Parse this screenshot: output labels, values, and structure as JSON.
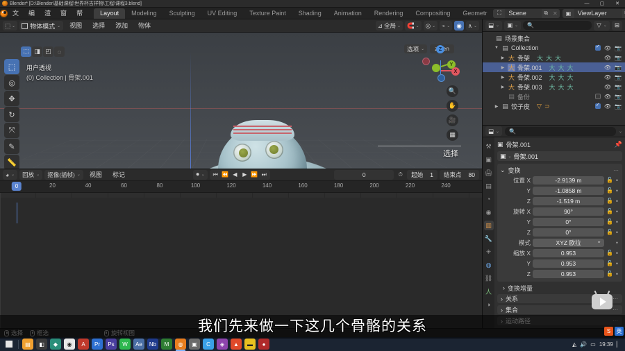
{
  "titlebar": {
    "app_title": "Blender* [D:\\Blender\\基础课程\\世界杯吉祥物\\工程\\课程3.blend]",
    "minimize": "—",
    "maximize": "▢",
    "close": "✕"
  },
  "topbar": {
    "menus": [
      "文件",
      "编辑",
      "渲染",
      "窗口",
      "帮助"
    ],
    "workspace_tabs": [
      {
        "label": "Layout",
        "active": true
      },
      {
        "label": "Modeling",
        "active": false
      },
      {
        "label": "Sculpting",
        "active": false
      },
      {
        "label": "UV Editing",
        "active": false
      },
      {
        "label": "Texture Paint",
        "active": false
      },
      {
        "label": "Shading",
        "active": false
      },
      {
        "label": "Animation",
        "active": false
      },
      {
        "label": "Rendering",
        "active": false
      },
      {
        "label": "Compositing",
        "active": false
      },
      {
        "label": "Geometr",
        "active": false
      }
    ],
    "scene_name": "Scene",
    "viewlayer_name": "ViewLayer",
    "scene_icon": "scene-icon",
    "viewlayer_icon": "viewlayer-icon",
    "new_icon": "new-copy-icon",
    "remove_icon": "remove-x-icon"
  },
  "viewport_header": {
    "editor_type_icon": "editor-type-3dview-icon",
    "mode": "物体模式",
    "menus": [
      "视图",
      "选择",
      "添加",
      "物体"
    ],
    "transform_orientation": "全局",
    "snap_icon": "magnet-icon",
    "proportional_icon": "proportional-edit-icon",
    "overlay_icon": "overlays-icon",
    "xray_icon": "xray-icon",
    "shading_modes": [
      "wireframe",
      "solid",
      "material-preview",
      "rendered"
    ],
    "shading_active": "solid"
  },
  "viewport": {
    "header_gizmos": [
      "select-box-icon",
      "select-tweak-icon",
      "select-lasso-icon",
      "select-circle-icon"
    ],
    "view_label_line1": "用户透视",
    "view_label_line2": "(0) Collection | 骨架.001",
    "options_label": "选项",
    "language_toggle": "zh/en",
    "select_label": "选择",
    "toolbar_icons": [
      "tweak-tool-icon",
      "cursor-tool-icon",
      "move-tool-icon",
      "rotate-tool-icon",
      "scale-tool-icon",
      "annotate-tool-icon",
      "measure-tool-icon",
      "add-cube-tool-icon"
    ],
    "nav_axes": [
      {
        "label": "Z",
        "color": "#4a8fe0"
      },
      {
        "label": "Y",
        "color": "#8cbd2a"
      },
      {
        "label": "X",
        "color": "#e0575f"
      }
    ],
    "nav_buttons": [
      "zoom-icon",
      "pan-hand-icon",
      "camera-view-icon",
      "toggle-ortho-grid-icon"
    ]
  },
  "timeline": {
    "editor_icon": "editor-type-timeline-icon",
    "playback_menu": "回放",
    "keying_menu": "抠像(插帧)",
    "menus": [
      "视图",
      "标记"
    ],
    "record_icon": "auto-key-record-icon",
    "transport": [
      "jump-start-icon",
      "prev-keyframe-icon",
      "play-reverse-icon",
      "play-icon",
      "next-keyframe-icon",
      "jump-end-icon"
    ],
    "current_frame": "0",
    "clock_icon": "clock-icon",
    "start_label": "起始",
    "start_value": "1",
    "end_label": "结束点",
    "end_value": "80",
    "ruler_ticks": [
      "0",
      "20",
      "40",
      "60",
      "80",
      "100",
      "120",
      "140",
      "160",
      "180",
      "200",
      "220",
      "240"
    ],
    "playhead_label": "0"
  },
  "outliner": {
    "display_mode_icon": "outliner-display-mode-icon",
    "filter_id_icon": "outliner-id-type-icon",
    "search_placeholder": "",
    "search_icon": "search-icon",
    "filter_icon": "filter-funnel-icon",
    "new_collection_icon": "new-collection-icon",
    "rows": [
      {
        "label": "场景集合",
        "icon": "collection-icon",
        "indent": 0,
        "disclosure": "",
        "selected": false,
        "dim": false,
        "checkbox": null,
        "eye": false,
        "camera": false,
        "armature_icons": []
      },
      {
        "label": "Collection",
        "icon": "collection-icon",
        "indent": 1,
        "disclosure": "▼",
        "selected": false,
        "dim": false,
        "checkbox": "on",
        "eye": true,
        "camera": true,
        "armature_icons": []
      },
      {
        "label": "骨架",
        "icon": "armature-icon",
        "indent": 2,
        "disclosure": "▶",
        "selected": false,
        "dim": false,
        "checkbox": null,
        "eye": true,
        "camera": true,
        "armature_icons": [
          "pose-icon",
          "armature-data-icon",
          "bone-icon"
        ]
      },
      {
        "label": "骨架.001",
        "icon": "armature-icon",
        "indent": 2,
        "disclosure": "▶",
        "selected": true,
        "dim": false,
        "checkbox": null,
        "eye": true,
        "camera": true,
        "armature_icons": [
          "pose-icon",
          "armature-data-icon",
          "bone-icon"
        ]
      },
      {
        "label": "骨架.002",
        "icon": "armature-icon",
        "indent": 2,
        "disclosure": "▶",
        "selected": false,
        "dim": false,
        "checkbox": null,
        "eye": true,
        "camera": true,
        "armature_icons": [
          "pose-icon",
          "armature-data-icon",
          "bone-icon"
        ]
      },
      {
        "label": "骨架.003",
        "icon": "armature-icon",
        "indent": 2,
        "disclosure": "▶",
        "selected": false,
        "dim": false,
        "checkbox": null,
        "eye": true,
        "camera": true,
        "armature_icons": [
          "pose-icon",
          "armature-data-icon",
          "bone-icon"
        ]
      },
      {
        "label": "备份",
        "icon": "collection-icon",
        "indent": 2,
        "disclosure": "",
        "selected": false,
        "dim": true,
        "checkbox": "off",
        "eye": true,
        "camera": true,
        "armature_icons": []
      },
      {
        "label": "饺子皮",
        "icon": "collection-icon",
        "indent": 1,
        "disclosure": "▶",
        "selected": false,
        "dim": false,
        "checkbox": "on",
        "eye": true,
        "camera": true,
        "armature_icons": [
          "mesh-data-icon",
          "modifier-icon"
        ]
      }
    ]
  },
  "properties": {
    "editor_icon": "editor-type-properties-icon",
    "search_placeholder": "",
    "search_icon": "search-icon",
    "options_caret": "⌄",
    "tabs": [
      {
        "name": "tool-tab",
        "glyph": "⚒",
        "active": false,
        "cls": ""
      },
      {
        "name": "render-tab",
        "glyph": "▣",
        "active": false,
        "cls": ""
      },
      {
        "name": "output-tab",
        "glyph": "🖨",
        "active": false,
        "cls": ""
      },
      {
        "name": "view-layer-tab",
        "glyph": "▤",
        "active": false,
        "cls": ""
      },
      {
        "name": "scene-tab",
        "glyph": "◔",
        "active": false,
        "cls": ""
      },
      {
        "name": "world-tab",
        "glyph": "◉",
        "active": false,
        "cls": ""
      },
      {
        "name": "object-tab",
        "glyph": "▥",
        "active": true,
        "cls": "orange"
      },
      {
        "name": "modifier-tab",
        "glyph": "🔧",
        "active": false,
        "cls": "blue"
      },
      {
        "name": "particles-tab",
        "glyph": "✳",
        "active": false,
        "cls": ""
      },
      {
        "name": "physics-tab",
        "glyph": "◍",
        "active": false,
        "cls": "blue"
      },
      {
        "name": "constraints-tab",
        "glyph": "⛓",
        "active": false,
        "cls": ""
      },
      {
        "name": "data-tab",
        "glyph": "人",
        "active": false,
        "cls": "green"
      },
      {
        "name": "material-tab",
        "glyph": "◑",
        "active": false,
        "cls": ""
      }
    ],
    "breadcrumb_icon": "object-icon",
    "breadcrumb_name": "骨架.001",
    "pin_icon": "pin-icon",
    "object_name_field": "骨架.001",
    "object_field_icon": "object-icon",
    "transform_panel": {
      "title": "变换",
      "dots": "⋯",
      "location_label": "位置",
      "location": [
        {
          "axis": "X",
          "value": "-2.9139 m"
        },
        {
          "axis": "Y",
          "value": "-1.0858 m"
        },
        {
          "axis": "Z",
          "value": "-1.519 m"
        }
      ],
      "rotation_label": "旋转",
      "rotation": [
        {
          "axis": "X",
          "value": "90°"
        },
        {
          "axis": "Y",
          "value": "0°"
        },
        {
          "axis": "Z",
          "value": "0°"
        }
      ],
      "mode_label": "模式",
      "mode_value": "XYZ 欧拉",
      "scale_label": "缩放",
      "scale": [
        {
          "axis": "X",
          "value": "0.953"
        },
        {
          "axis": "Y",
          "value": "0.953"
        },
        {
          "axis": "Z",
          "value": "0.953"
        }
      ],
      "lock_icon": "unlocked-padlock-icon",
      "animate_icon": "animate-dot-icon"
    },
    "delta_transform_label": "变换增量",
    "collapsed_panels": [
      "关系",
      "集合",
      "运动路径"
    ]
  },
  "statusbar": {
    "items": [
      {
        "icon": "mouse-left-icon",
        "label": "选择"
      },
      {
        "icon": "mouse-left-drag-icon",
        "label": "框选"
      },
      {
        "icon": "mouse-middle-icon",
        "label": "旋转视图"
      }
    ],
    "version": ""
  },
  "taskbar": {
    "start_icon": "windows-start-icon",
    "apps": [
      {
        "name": "file-explorer",
        "color": "#f0a030",
        "glyph": "▤"
      },
      {
        "name": "app-dark",
        "color": "#3a3a3a",
        "glyph": "◧"
      },
      {
        "name": "app-teal",
        "color": "#2a8f7a",
        "glyph": "◆"
      },
      {
        "name": "chrome",
        "color": "#e8e8e8",
        "glyph": "◉"
      },
      {
        "name": "app-red",
        "color": "#c0392b",
        "glyph": "A"
      },
      {
        "name": "app-blue",
        "color": "#2d6fd0",
        "glyph": "Pr"
      },
      {
        "name": "app-violet",
        "color": "#4a3fa0",
        "glyph": "Ps"
      },
      {
        "name": "wechat",
        "color": "#2eb84f",
        "glyph": "W"
      },
      {
        "name": "app-slate",
        "color": "#4a6fa5",
        "glyph": "Ae"
      },
      {
        "name": "app-navy",
        "color": "#1f3a8c",
        "glyph": "Nb"
      },
      {
        "name": "app-green",
        "color": "#2e7d32",
        "glyph": "M"
      },
      {
        "name": "blender-task",
        "color": "#e87d1e",
        "glyph": "◍"
      },
      {
        "name": "app-grey",
        "color": "#6a6a6a",
        "glyph": "▣"
      },
      {
        "name": "app-lightblue",
        "color": "#3aa0e8",
        "glyph": "C"
      },
      {
        "name": "app-purple",
        "color": "#8e44ad",
        "glyph": "◈"
      },
      {
        "name": "app-orange2",
        "color": "#e04a2a",
        "glyph": "▲"
      },
      {
        "name": "app-yellow",
        "color": "#e8c020",
        "glyph": "▬"
      },
      {
        "name": "app-record",
        "color": "#b02a2a",
        "glyph": "●"
      }
    ],
    "clock": "19:39",
    "tray_icons": [
      "network-icon",
      "volume-icon",
      "battery-icon",
      "show-desktop-icon"
    ]
  },
  "subtitle": {
    "text": "我们先来做一下这几个骨骼的关系"
  },
  "ime": {
    "sogou_label": "S",
    "second_label": "英"
  }
}
